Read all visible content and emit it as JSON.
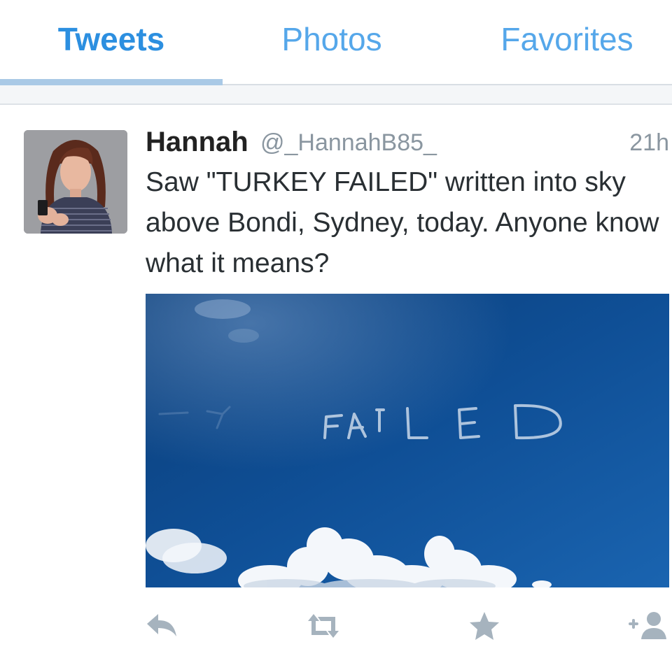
{
  "tabs": [
    {
      "label": "Tweets",
      "active": true
    },
    {
      "label": "Photos",
      "active": false
    },
    {
      "label": "Favorites",
      "active": false
    }
  ],
  "tweet": {
    "display_name": "Hannah",
    "handle": "@_HannahB85_",
    "timestamp": "21h",
    "text": "Saw \"TURKEY FAILED\" written into sky above Bondi, Sydney, today. Anyone know what it means?",
    "media": {
      "skywriting_visible_text": "FAILED"
    },
    "actions": [
      {
        "name": "reply",
        "icon": "reply-icon"
      },
      {
        "name": "retweet",
        "icon": "retweet-icon"
      },
      {
        "name": "favorite",
        "icon": "star-icon"
      },
      {
        "name": "follow",
        "icon": "add-user-icon"
      }
    ]
  },
  "colors": {
    "accent": "#2c8fe0",
    "tab_inactive": "#55a7ea",
    "icon_gray": "#a6b3be",
    "sky_blue": "#0e4a8c"
  }
}
